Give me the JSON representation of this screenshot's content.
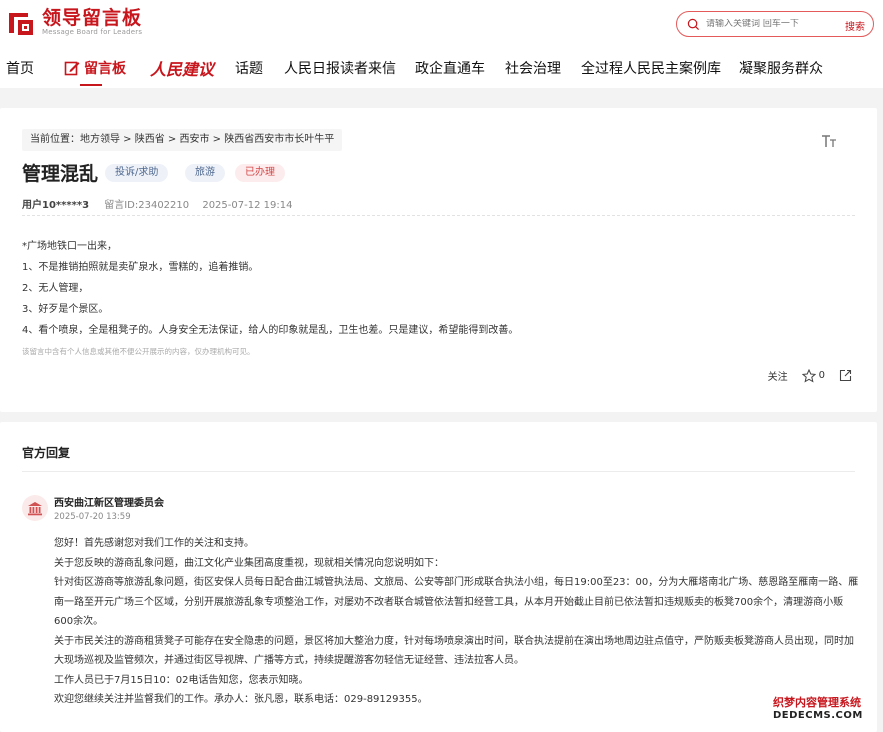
{
  "header": {
    "logo_title": "领导留言板",
    "logo_subtitle": "Message Board for Leaders",
    "search_placeholder": "请输入关键词 回车一下",
    "search_button": "搜索"
  },
  "nav": {
    "home": "首页",
    "message_board": "留言板",
    "rmjy": "人民建议",
    "topics": "话题",
    "letters": "人民日报读者来信",
    "politics": "政企直通车",
    "governance": "社会治理",
    "democracy": "全过程人民民主案例库",
    "service": "凝聚服务群众"
  },
  "message": {
    "breadcrumb": "当前位置：地方领导 > 陕西省 > 西安市 > 陕西省西安市市长叶牛平",
    "font_toggle": "TT",
    "title": "管理混乱",
    "tags": [
      "投诉/求助",
      "旅游",
      "已办理"
    ],
    "user": "用户10*****3",
    "message_id": "留言ID:23402210",
    "time": "2025-07-12 19:14",
    "lines": [
      "*广场地铁口一出来，",
      "1、不是推销拍照就是卖矿泉水，雪糕的，追着推销。",
      "2、无人管理，",
      "3、好歹是个景区。",
      "4、看个喷泉，全是租凳子的。人身安全无法保证，给人的印象就是乱，卫生也差。只是建议，希望能得到改善。"
    ],
    "notice": "该留言中含有个人信息或其他不便公开展示的内容，仅办理机构可见。",
    "follow": "关注",
    "like_count": "0"
  },
  "reply": {
    "heading": "官方回复",
    "org": "西安曲江新区管理委员会",
    "time": "2025-07-20 13:59",
    "paragraphs": [
      "您好！首先感谢您对我们工作的关注和支持。",
      "关于您反映的游商乱象问题，曲江文化产业集团高度重视，现就相关情况向您说明如下：",
      "针对街区游商等旅游乱象问题，街区安保人员每日配合曲江城管执法局、文旅局、公安等部门形成联合执法小组，每日19:00至23：00，分为大雁塔南北广场、慈恩路至雁南一路、雁南一路至开元广场三个区域，分别开展旅游乱象专项整治工作，对屡劝不改者联合城管依法暂扣经营工具，从本月开始截止目前已依法暂扣违规贩卖的板凳700余个，清理游商小贩600余次。",
      "关于市民关注的游商租赁凳子可能存在安全隐患的问题，景区将加大整治力度，针对每场喷泉演出时间，联合执法提前在演出场地周边驻点值守，严防贩卖板凳游商人员出现，同时加大现场巡视及监管频次，并通过街区导视牌、广播等方式，持续提醒游客勿轻信无证经营、违法拉客人员。",
      "工作人员已于7月15日10：02电话告知您，您表示知晓。",
      "欢迎您继续关注并监督我们的工作。承办人：张凡恩，联系电话：029-89129355。"
    ]
  },
  "watermark": {
    "line1": "织梦内容管理系统",
    "line2": "DEDECMS.COM"
  },
  "colors": {
    "brand_red": "#c8161d",
    "tag_blue_bg": "#eef2f8",
    "tag_red_bg": "#fdeced"
  }
}
